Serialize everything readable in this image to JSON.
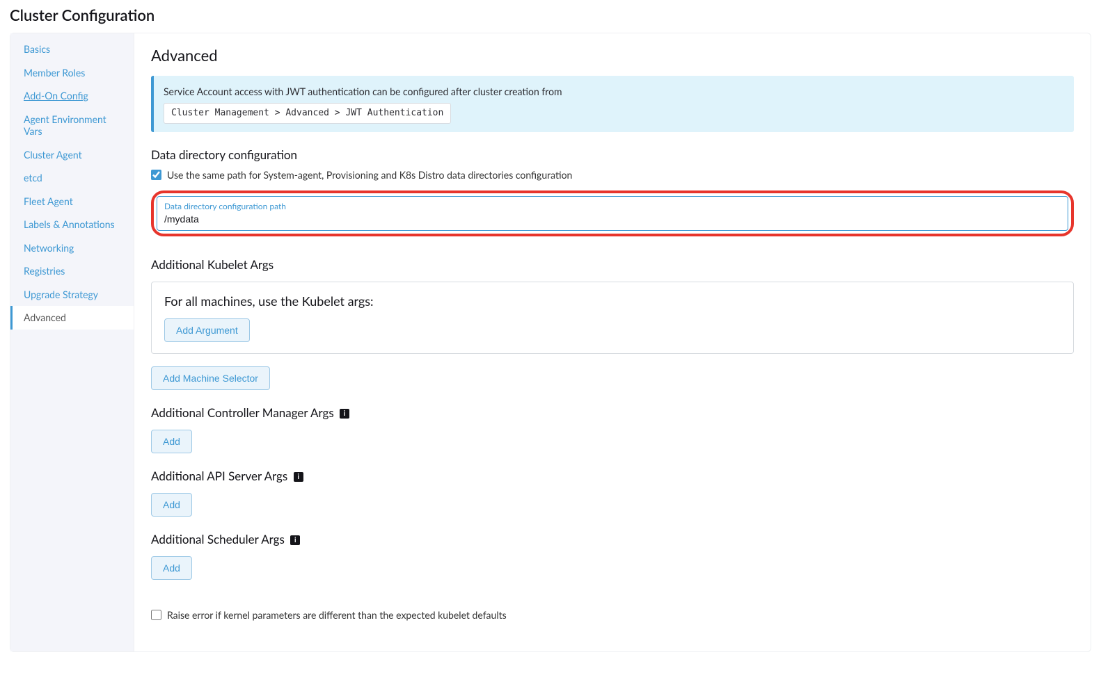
{
  "pageTitle": "Cluster Configuration",
  "sidebar": {
    "items": [
      {
        "label": "Basics"
      },
      {
        "label": "Member Roles"
      },
      {
        "label": "Add-On Config",
        "underline": true
      },
      {
        "label": "Agent Environment Vars"
      },
      {
        "label": "Cluster Agent"
      },
      {
        "label": "etcd"
      },
      {
        "label": "Fleet Agent"
      },
      {
        "label": "Labels & Annotations"
      },
      {
        "label": "Networking"
      },
      {
        "label": "Registries"
      },
      {
        "label": "Upgrade Strategy"
      },
      {
        "label": "Advanced",
        "active": true
      }
    ]
  },
  "advanced": {
    "title": "Advanced",
    "banner": {
      "text": "Service Account access with JWT authentication can be configured after cluster creation from",
      "code": "Cluster Management > Advanced > JWT Authentication"
    },
    "dataDir": {
      "heading": "Data directory configuration",
      "checkboxLabel": "Use the same path for System-agent, Provisioning and K8s Distro data directories configuration",
      "fieldLabel": "Data directory configuration path",
      "value": "/mydata"
    },
    "kubeletArgs": {
      "heading": "Additional Kubelet Args",
      "boxTitle": "For all machines, use the Kubelet args:",
      "addArgumentLabel": "Add Argument",
      "addMachineSelectorLabel": "Add Machine Selector"
    },
    "controllerManagerArgs": {
      "heading": "Additional Controller Manager Args",
      "addLabel": "Add"
    },
    "apiServerArgs": {
      "heading": "Additional API Server Args",
      "addLabel": "Add"
    },
    "schedulerArgs": {
      "heading": "Additional Scheduler Args",
      "addLabel": "Add"
    },
    "kernelCheckbox": {
      "label": "Raise error if kernel parameters are different than the expected kubelet defaults"
    }
  }
}
